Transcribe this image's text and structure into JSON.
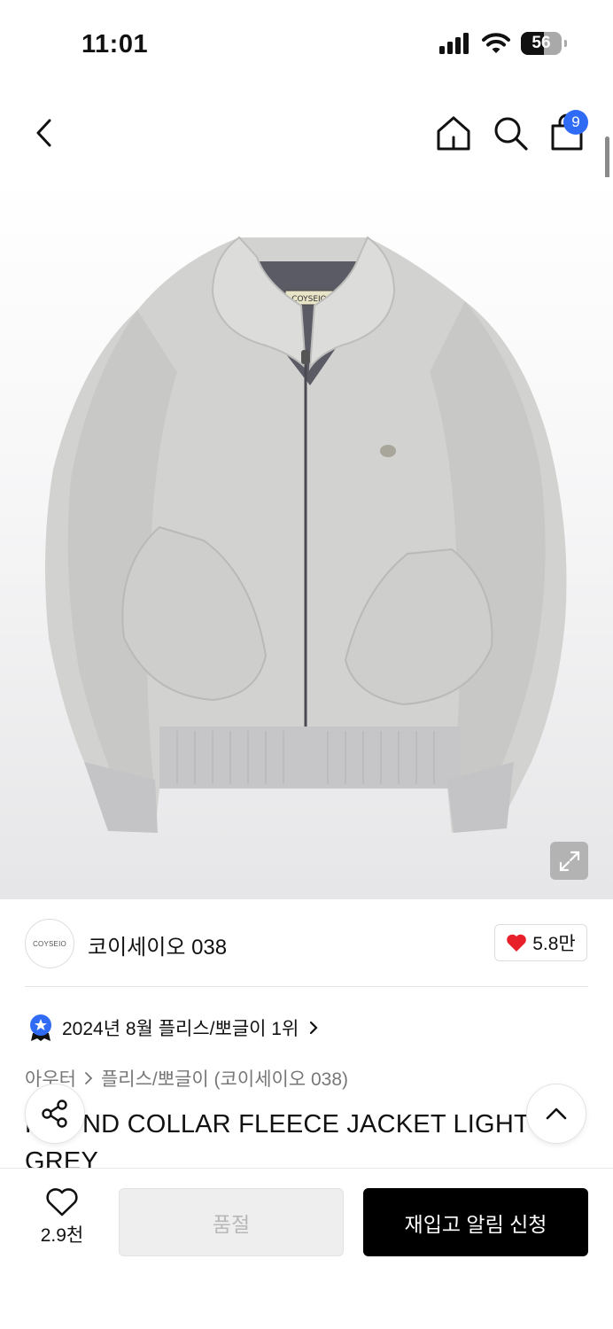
{
  "status_bar": {
    "time": "11:01",
    "battery": "56",
    "battery_level": 0.56
  },
  "nav": {
    "cart_count": "9"
  },
  "brand": {
    "logo_text": "COYSEIO",
    "name": "코이세이오 038",
    "like_count": "5.8만"
  },
  "ranking": {
    "text": "2024년 8월 플리스/뽀글이 1위"
  },
  "breadcrumb": {
    "category": "아우터",
    "subcategory": "플리스/뽀글이 (코이세이오 038)"
  },
  "product": {
    "title": "ROUND COLLAR FLEECE JACKET LIGHT GREY",
    "label_text": "COYSEIO"
  },
  "bottom": {
    "wish_count": "2.9천",
    "soldout_label": "품절",
    "restock_label": "재입고 알림 신청"
  },
  "colors": {
    "accent": "#2f6bf5",
    "heart": "#e8202a",
    "primary_button": "#000000"
  },
  "icons": [
    "back-icon",
    "home-icon",
    "search-icon",
    "cart-icon",
    "expand-icon",
    "heart-icon",
    "ranking-badge-icon",
    "chevron-right-icon",
    "share-icon",
    "chevron-up-icon"
  ]
}
